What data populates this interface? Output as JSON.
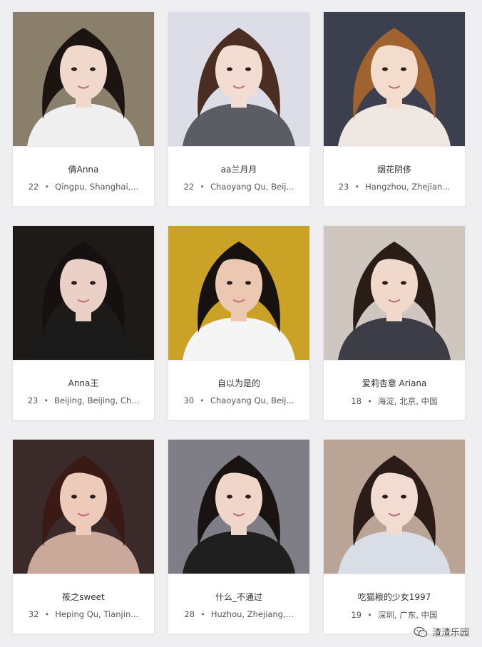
{
  "profiles": [
    {
      "name": "倩Anna",
      "age": "22",
      "location": "Qingpu, Shanghai,...",
      "palette": {
        "bg": "#8a7f6b",
        "hair": "#1c1410",
        "skin": "#f0d9cc",
        "cloth": "#efefef"
      }
    },
    {
      "name": "aa兰月月",
      "age": "22",
      "location": "Chaoyang Qu, Beij...",
      "palette": {
        "bg": "#dcdde6",
        "hair": "#4a2e22",
        "skin": "#f3ddd2",
        "cloth": "#5c5c64"
      }
    },
    {
      "name": "烟花阴侈",
      "age": "23",
      "location": "Hangzhou, Zhejian...",
      "palette": {
        "bg": "#3b3f4e",
        "hair": "#a0622f",
        "skin": "#f4dccd",
        "cloth": "#efe7e2"
      }
    },
    {
      "name": "Anna王",
      "age": "23",
      "location": "Beijing, Beijing, Ch...",
      "palette": {
        "bg": "#1e1a18",
        "hair": "#161110",
        "skin": "#ead0c6",
        "cloth": "#1a1a1a"
      }
    },
    {
      "name": "自以为是的",
      "age": "30",
      "location": "Chaoyang Qu, Beij...",
      "palette": {
        "bg": "#c9a226",
        "hair": "#17110f",
        "skin": "#ecc8b2",
        "cloth": "#f5f5f5"
      }
    },
    {
      "name": "爱莉杏意 Ariana",
      "age": "18",
      "location": "海淀, 北京, 中国",
      "palette": {
        "bg": "#cfc6bf",
        "hair": "#2a1d18",
        "skin": "#f0d8cb",
        "cloth": "#3d3d47"
      }
    },
    {
      "name": "筱之sweet",
      "age": "32",
      "location": "Heping Qu, Tianjin...",
      "palette": {
        "bg": "#3a2a2a",
        "hair": "#3b1a16",
        "skin": "#edcab9",
        "cloth": "#caa89a"
      }
    },
    {
      "name": "什么_不通过",
      "age": "28",
      "location": "Huzhou, Zhejiang,...",
      "palette": {
        "bg": "#7f7e86",
        "hair": "#191312",
        "skin": "#f0d6c8",
        "cloth": "#1f1f1f"
      }
    },
    {
      "name": "吃猫粮的少女1997",
      "age": "19",
      "location": "深圳, 广东, 中国",
      "palette": {
        "bg": "#b9a495",
        "hair": "#2b1c17",
        "skin": "#f2dcd1",
        "cloth": "#d9dde6"
      }
    }
  ],
  "separator": "•",
  "watermark": {
    "text": "渣渣乐园",
    "icon": "wechat-icon"
  }
}
